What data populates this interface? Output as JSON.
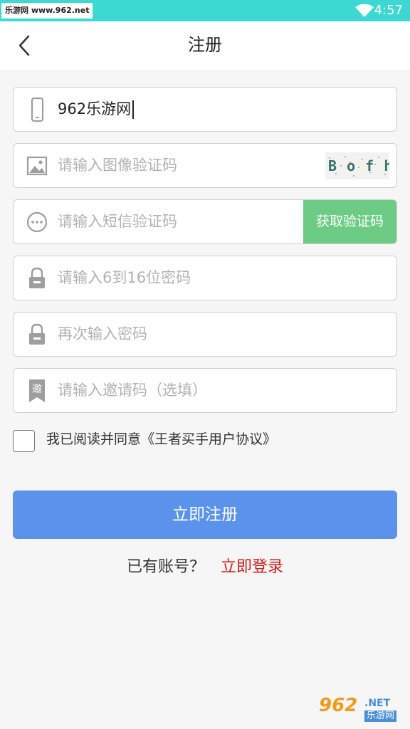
{
  "status_bar": {
    "watermark": "乐游网 www.962.net",
    "time": "4:57"
  },
  "header": {
    "title": "注册"
  },
  "form": {
    "phone": {
      "value": "962乐游网",
      "icon": "phone-icon"
    },
    "image_code": {
      "placeholder": "请输入图像验证码",
      "icon": "image-icon",
      "captcha_text": "B o f h"
    },
    "sms_code": {
      "placeholder": "请输入短信验证码",
      "icon": "chat-icon",
      "button_label": "获取验证码"
    },
    "password": {
      "placeholder": "请输入6到16位密码",
      "icon": "lock-icon"
    },
    "password_confirm": {
      "placeholder": "再次输入密码",
      "icon": "lock-icon"
    },
    "invite_code": {
      "placeholder": "请输入邀请码（选填）",
      "icon": "invite-bookmark-icon",
      "icon_glyph": "邀"
    }
  },
  "agreement": {
    "checked": false,
    "text": "我已阅读并同意《王者买手用户协议》"
  },
  "submit": {
    "label": "立即注册"
  },
  "login": {
    "question": "已有账号？",
    "link_label": "立即登录"
  },
  "logo": {
    "number": "962",
    "net": ".NET",
    "cn": "乐游网"
  },
  "colors": {
    "status_bar": "#3cd8d2",
    "sms_button": "#6dcc84",
    "submit_button": "#5b93ec",
    "login_link": "#d81b1b"
  }
}
